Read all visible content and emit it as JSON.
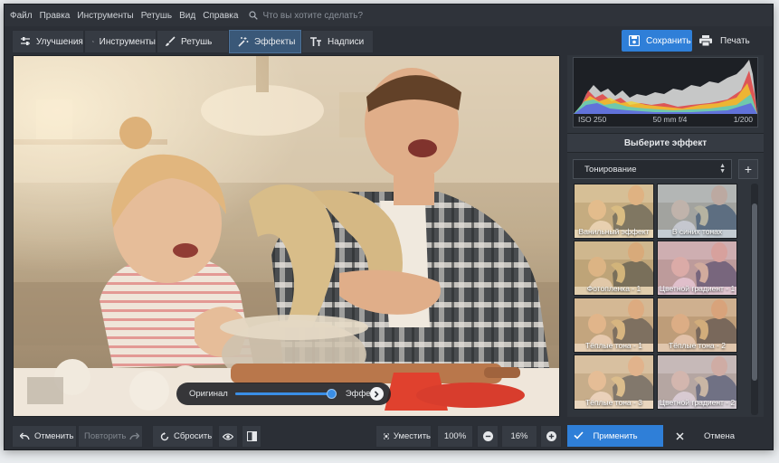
{
  "menu": {
    "items": [
      "Файл",
      "Правка",
      "Инструменты",
      "Ретушь",
      "Вид",
      "Справка"
    ],
    "search_placeholder": "Что вы хотите сделать?"
  },
  "tabs": [
    {
      "label": "Улучшения",
      "icon": "sliders-icon"
    },
    {
      "label": "Инструменты",
      "icon": "crop-icon"
    },
    {
      "label": "Ретушь",
      "icon": "brush-icon"
    },
    {
      "label": "Эффекты",
      "icon": "magic-wand-icon",
      "active": true
    },
    {
      "label": "Надписи",
      "icon": "text-icon"
    }
  ],
  "toolbar": {
    "save_label": "Сохранить",
    "print_label": "Печать"
  },
  "histogram": {
    "iso": "ISO 250",
    "lens": "50 mm f/4",
    "shutter": "1/200"
  },
  "effects_panel": {
    "title": "Выберите эффект",
    "category": "Тонирование",
    "thumbnails": [
      {
        "label": "Ванильный эффект",
        "tint": "#d9b56e"
      },
      {
        "label": "В синих тонах",
        "tint": "#7f9fbf"
      },
      {
        "label": "Фотопленка - 1",
        "tint": "#c7a15a"
      },
      {
        "label": "Цветной градиент - 1",
        "tint": "#c489b5"
      },
      {
        "label": "Тёплые тона - 1",
        "tint": "#d6a46a"
      },
      {
        "label": "Тёплые тона - 2",
        "tint": "#c98d5b"
      },
      {
        "label": "Тёплые тона - 3",
        "tint": "#e0b78a"
      },
      {
        "label": "Цветной градиент - 2",
        "tint": "#b0a6c7"
      }
    ]
  },
  "compare": {
    "left_label": "Оригинал",
    "right_label": "Эффект",
    "position": 0.95
  },
  "bottom": {
    "undo": "Отменить",
    "redo": "Повторить",
    "reset": "Сбросить",
    "fit": "Уместить",
    "zoom_100": "100%",
    "zoom_value": "16%",
    "apply": "Применить",
    "cancel": "Отмена"
  },
  "colors": {
    "accent": "#2f7fd8",
    "panel": "#30353c",
    "window": "#2b2f36"
  }
}
